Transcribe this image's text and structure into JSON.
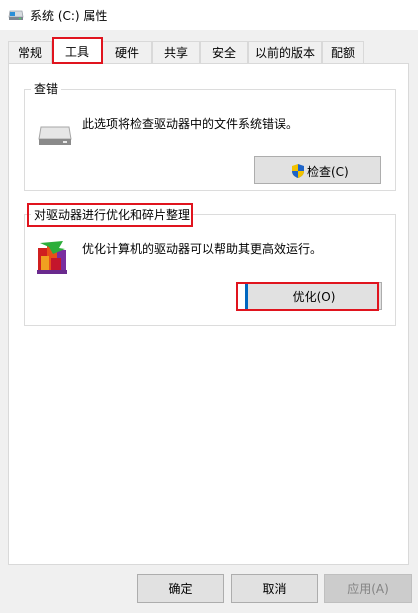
{
  "window": {
    "title": "系统 (C:) 属性",
    "icon": "drive-icon"
  },
  "tabs": [
    {
      "label": "常规"
    },
    {
      "label": "工具",
      "active": true
    },
    {
      "label": "硬件"
    },
    {
      "label": "共享"
    },
    {
      "label": "安全"
    },
    {
      "label": "以前的版本"
    },
    {
      "label": "配额"
    }
  ],
  "error_check": {
    "group_title": "查错",
    "description": "此选项将检查驱动器中的文件系统错误。",
    "button_label": "检查(C)",
    "icon": "hard-drive-icon",
    "button_icon": "uac-shield-icon"
  },
  "optimize": {
    "group_title": "对驱动器进行优化和碎片整理",
    "description": "优化计算机的驱动器可以帮助其更高效运行。",
    "button_label": "优化(O)",
    "icon": "defrag-icon"
  },
  "footer": {
    "ok_label": "确定",
    "cancel_label": "取消",
    "apply_label": "应用(A)",
    "apply_enabled": false
  },
  "colors": {
    "highlight": "#e0141e",
    "accent": "#0067c0"
  }
}
